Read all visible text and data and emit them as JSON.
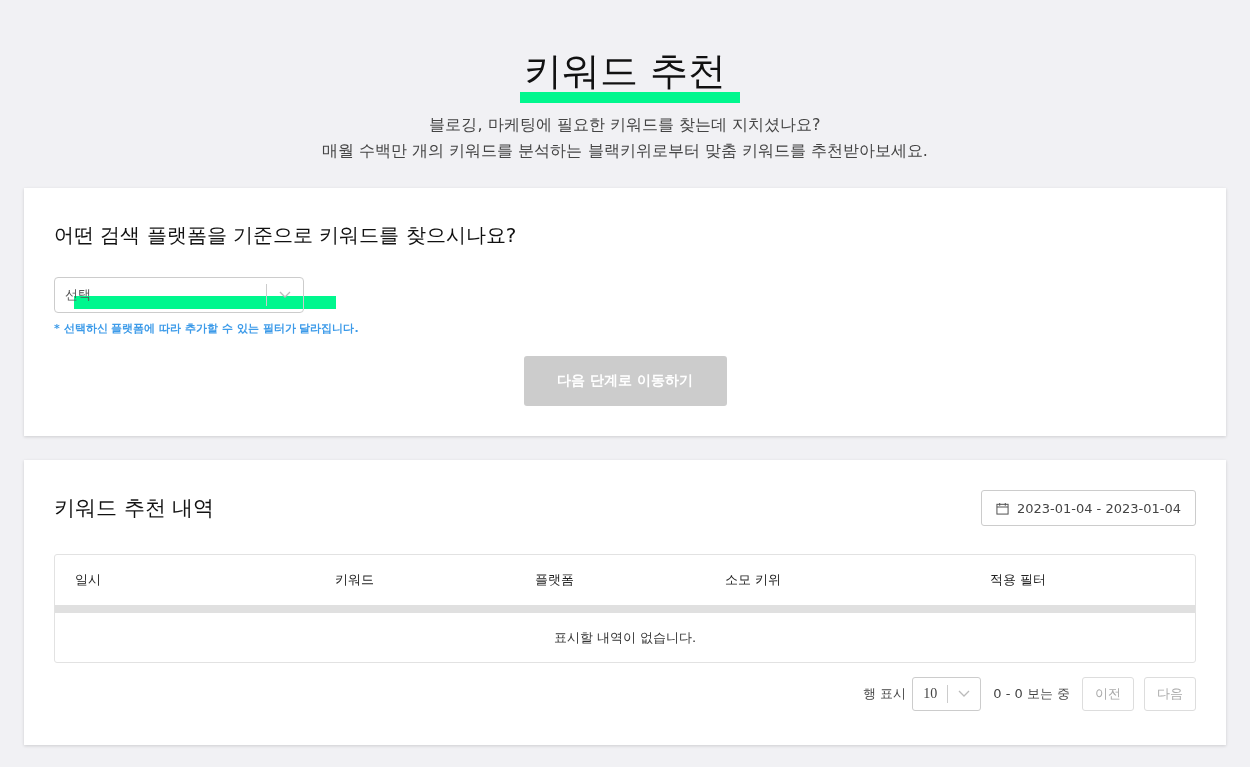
{
  "header": {
    "title": "키워드 추천",
    "subtitle_lines": [
      "블로깅, 마케팅에 필요한 키워드를 찾는데 지치셨나요?",
      "매월 수백만 개의 키워드를 분석하는 블랙키위로부터 맞춤 키워드를 추천받아보세요."
    ]
  },
  "platform_card": {
    "question": "어떤 검색 플랫폼을 기준으로 키워드를 찾으시나요?",
    "select": {
      "placeholder": "선택"
    },
    "hint": "* 선택하신 플랫폼에 따라 추가할 수 있는 필터가 달라집니다.",
    "next_button": {
      "label": "다음 단계로 이동하기",
      "disabled": true
    }
  },
  "history_card": {
    "title": "키워드 추천 내역",
    "date_range": "2023-01-04 - 2023-01-04",
    "table": {
      "columns": [
        "일시",
        "키워드",
        "플랫폼",
        "소모 키위",
        "적용 필터"
      ],
      "empty_message": "표시할 내역이 없습니다."
    },
    "pagination": {
      "rows_label": "행 표시",
      "rows_value": "10",
      "range": "0 - 0 보는 중",
      "prev": {
        "label": "이전",
        "disabled": true
      },
      "next": {
        "label": "다음",
        "disabled": true
      }
    }
  }
}
